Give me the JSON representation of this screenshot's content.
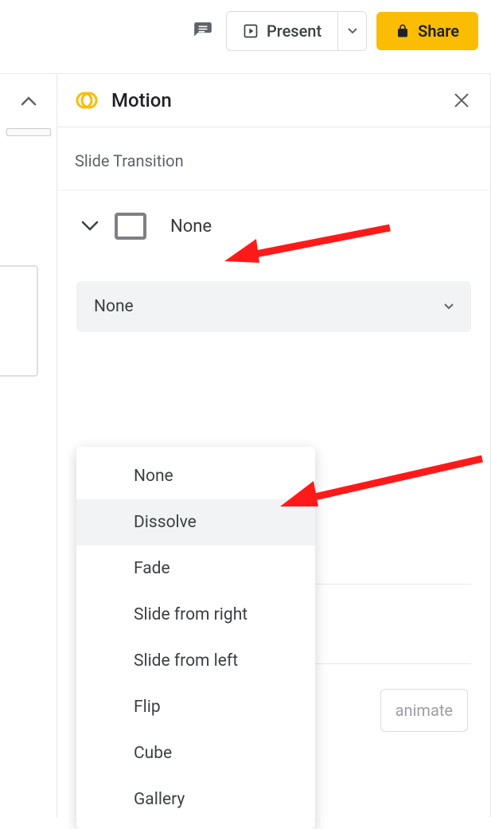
{
  "toolbar": {
    "present_label": "Present",
    "share_label": "Share"
  },
  "panel": {
    "title": "Motion",
    "section_label": "Slide Transition",
    "current_transition": "None"
  },
  "dropdown": {
    "selected": "None",
    "options": [
      {
        "label": "None",
        "highlighted": false
      },
      {
        "label": "Dissolve",
        "highlighted": true
      },
      {
        "label": "Fade",
        "highlighted": false
      },
      {
        "label": "Slide from right",
        "highlighted": false
      },
      {
        "label": "Slide from left",
        "highlighted": false
      },
      {
        "label": "Flip",
        "highlighted": false
      },
      {
        "label": "Cube",
        "highlighted": false
      },
      {
        "label": "Gallery",
        "highlighted": false
      }
    ]
  },
  "behind": {
    "animate_text": "animate"
  },
  "colors": {
    "accent": "#fbbc04",
    "arrow": "#ff1a1a"
  }
}
